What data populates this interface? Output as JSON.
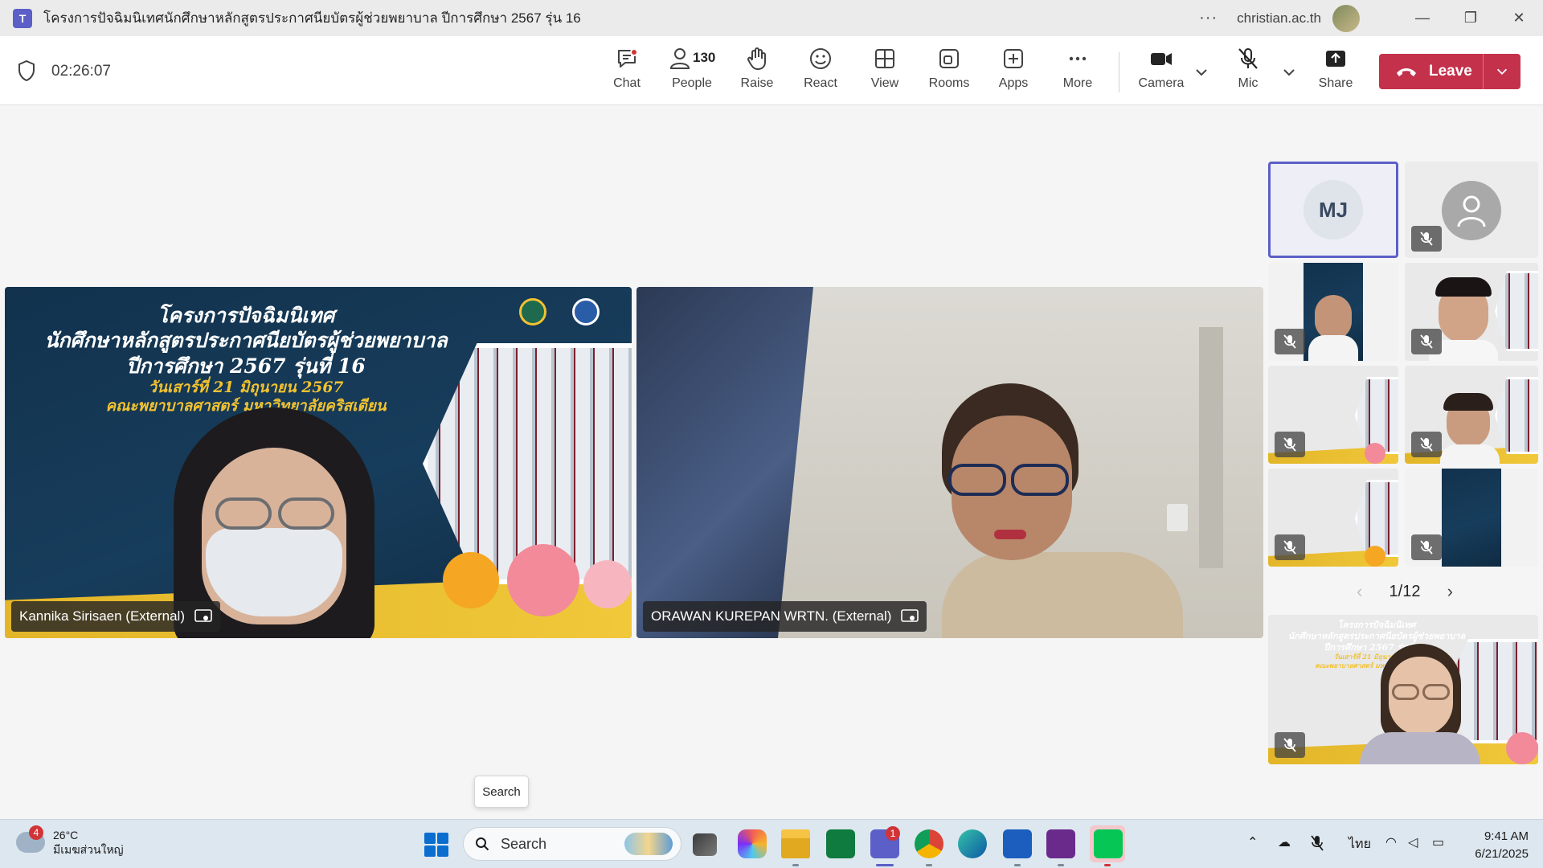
{
  "window": {
    "title": "โครงการปัจฉิมนิเทศนักศึกษาหลักสูตรประกาศนียบัตรผู้ช่วยพยาบาล ปีการศึกษา 2567 รุ่น 16",
    "app_logo": "T",
    "account": "christian.ac.th",
    "more_label": "···",
    "minimize": "—",
    "maximize": "❐",
    "close": "✕"
  },
  "toolbar": {
    "timer": "02:26:07",
    "chat_label": "Chat",
    "people_label": "People",
    "people_count": "130",
    "raise_label": "Raise",
    "react_label": "React",
    "view_label": "View",
    "rooms_label": "Rooms",
    "apps_label": "Apps",
    "more_label": "More",
    "camera_label": "Camera",
    "mic_label": "Mic",
    "share_label": "Share",
    "leave_label": "Leave"
  },
  "banner": {
    "line1": "โครงการปัจฉิมนิเทศ",
    "line2": "นักศึกษาหลักสูตรประกาศนียบัตรผู้ช่วยพยาบาล",
    "line3": "ปีการศึกษา 2567 รุ่นที่ 16",
    "line4": "วันเสาร์ที่ 21 มิถุนายน 2567",
    "line5": "คณะพยาบาลศาสตร์ มหาวิทยาลัยคริสเตียน"
  },
  "main_tiles": [
    {
      "name": "Kannika Sirisaen (External)"
    },
    {
      "name": "ORAWAN KUREPAN WRTN. (External)"
    }
  ],
  "side": {
    "mj_initials": "MJ",
    "page_indicator": "1/12",
    "prev": "‹",
    "next": "›"
  },
  "tooltip": {
    "text": "Search"
  },
  "taskbar": {
    "weather_temp": "26°C",
    "weather_desc": "มีเมฆส่วนใหญ่",
    "weather_badge": "4",
    "search_label": "Search",
    "teams_badge": "1",
    "language": "ไทย",
    "time": "9:41 AM",
    "date": "6/21/2025"
  },
  "colors": {
    "accent": "#5b5fc7",
    "leave": "#c4314b",
    "banner_navy": "#12324d",
    "banner_gold": "#f2c230"
  }
}
